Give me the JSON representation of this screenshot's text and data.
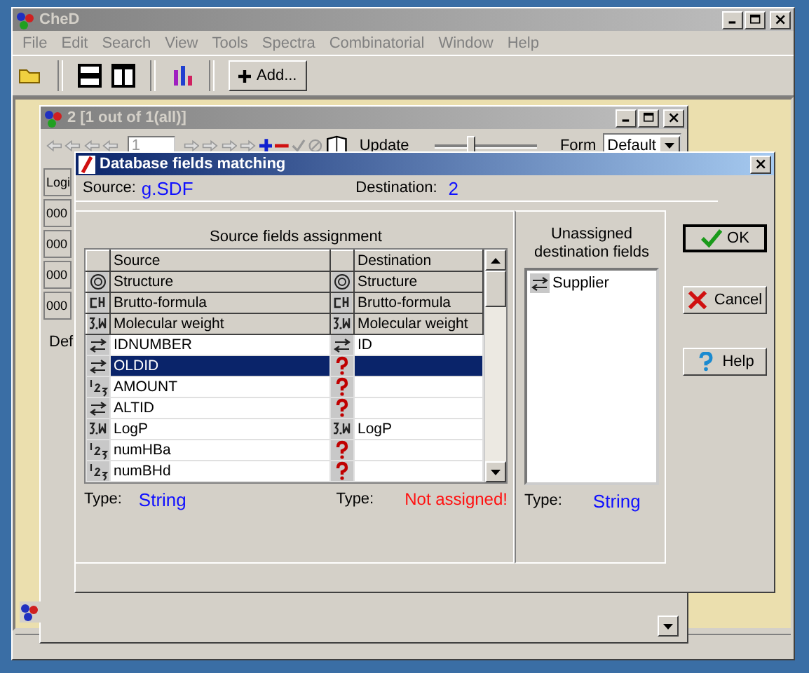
{
  "window": {
    "title": "CheD"
  },
  "menu": [
    "File",
    "Edit",
    "Search",
    "View",
    "Tools",
    "Spectra",
    "Combinatorial",
    "Window",
    "Help"
  ],
  "toolbar": {
    "add_button": "Add..."
  },
  "child_window": {
    "title": "2 [1 out of 1(all)]",
    "record_field": "1",
    "update_label": "Update",
    "slider": {
      "level": 0.35
    },
    "form_label": "Form",
    "form_select": "Default",
    "side_cells": [
      "Logi",
      "000",
      "000",
      "000",
      "000"
    ],
    "tab_label": "Def"
  },
  "dialog": {
    "title": "Database fields matching",
    "source_label": "Source:",
    "source_value": "g.SDF",
    "destination_label": "Destination:",
    "destination_value": "2",
    "group_title": "Source fields assignment",
    "columns": [
      "Source",
      "Destination"
    ],
    "rows": [
      {
        "kind": "fixed",
        "source": {
          "kind": "structure",
          "name": "Structure"
        },
        "destination": {
          "kind": "structure",
          "name": "Structure"
        },
        "selected": false
      },
      {
        "kind": "fixed",
        "source": {
          "kind": "formula",
          "name": "Brutto-formula"
        },
        "destination": {
          "kind": "formula",
          "name": "Brutto-formula"
        },
        "selected": false
      },
      {
        "kind": "fixed",
        "source": {
          "kind": "float",
          "name": "Molecular weight"
        },
        "destination": {
          "kind": "float",
          "name": "Molecular weight"
        },
        "selected": false
      },
      {
        "kind": "field",
        "source": {
          "kind": "string",
          "name": "IDNUMBER"
        },
        "destination": {
          "kind": "string",
          "name": "ID"
        },
        "selected": false
      },
      {
        "kind": "field",
        "source": {
          "kind": "string",
          "name": "OLDID"
        },
        "destination": {
          "kind": "unknown"
        },
        "selected": true
      },
      {
        "kind": "field",
        "source": {
          "kind": "integer",
          "name": "AMOUNT"
        },
        "destination": {
          "kind": "unknown"
        },
        "selected": false
      },
      {
        "kind": "field",
        "source": {
          "kind": "string",
          "name": "ALTID"
        },
        "destination": {
          "kind": "unknown"
        },
        "selected": false
      },
      {
        "kind": "field",
        "source": {
          "kind": "float",
          "name": "LogP"
        },
        "destination": {
          "kind": "float",
          "name": "LogP"
        },
        "selected": false
      },
      {
        "kind": "field",
        "source": {
          "kind": "integer",
          "name": "numHBa"
        },
        "destination": {
          "kind": "unknown"
        },
        "selected": false
      },
      {
        "kind": "field",
        "source": {
          "kind": "integer",
          "name": "numBHd"
        },
        "destination": {
          "kind": "unknown"
        },
        "selected": false
      }
    ],
    "source_type_label": "Type:",
    "source_type_value": "String",
    "dest_type_label": "Type:",
    "dest_type_value": "Not assigned!",
    "unassigned_title": "Unassigned destination fields",
    "unassigned": [
      {
        "kind": "string",
        "name": "Supplier"
      }
    ],
    "unassigned_type_label": "Type:",
    "unassigned_type_value": "String",
    "buttons": [
      {
        "kind": "ok",
        "label": "OK"
      },
      {
        "kind": "cancel",
        "label": "Cancel"
      },
      {
        "kind": "help",
        "label": "Help"
      }
    ]
  }
}
